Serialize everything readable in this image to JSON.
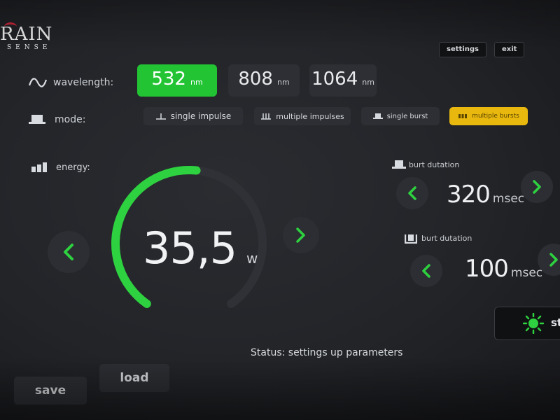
{
  "brand": {
    "name_top": "RAIN",
    "name_bottom": "SENSE",
    "accent": "#c8253a"
  },
  "header": {
    "settings_label": "settings",
    "exit_label": "exit"
  },
  "wavelength": {
    "label": "wavelength:",
    "icon": "sine-wave-icon",
    "options": [
      {
        "value": "532",
        "unit": "nm",
        "selected": true
      },
      {
        "value": "808",
        "unit": "nm",
        "selected": false
      },
      {
        "value": "1064",
        "unit": "nm",
        "selected": false
      }
    ]
  },
  "mode": {
    "label": "mode:",
    "icon": "pulse-icon",
    "options": [
      {
        "label": "single impulse",
        "selected": false
      },
      {
        "label": "multiple impulses",
        "selected": false
      },
      {
        "label": "single burst",
        "selected": false
      },
      {
        "label": "multiple bursts",
        "selected": true
      }
    ]
  },
  "energy": {
    "label": "energy:",
    "icon": "bars-icon",
    "value": "35,5",
    "unit": "w",
    "level_fraction": 0.52
  },
  "burst_duration_1": {
    "label": "burt dutation",
    "value": "320",
    "unit": "msec"
  },
  "burst_duration_2": {
    "label": "burt dutation",
    "value": "100",
    "unit": "msec"
  },
  "status": {
    "text": "Status: settings up parameters"
  },
  "footer": {
    "save_label": "save",
    "load_label": "load",
    "start_label": "st"
  },
  "colors": {
    "accent_green": "#2ed13f",
    "selected_green": "#22c434",
    "selected_yellow": "#e9b80f",
    "background": "#222428",
    "panel": "#2d2f34"
  }
}
